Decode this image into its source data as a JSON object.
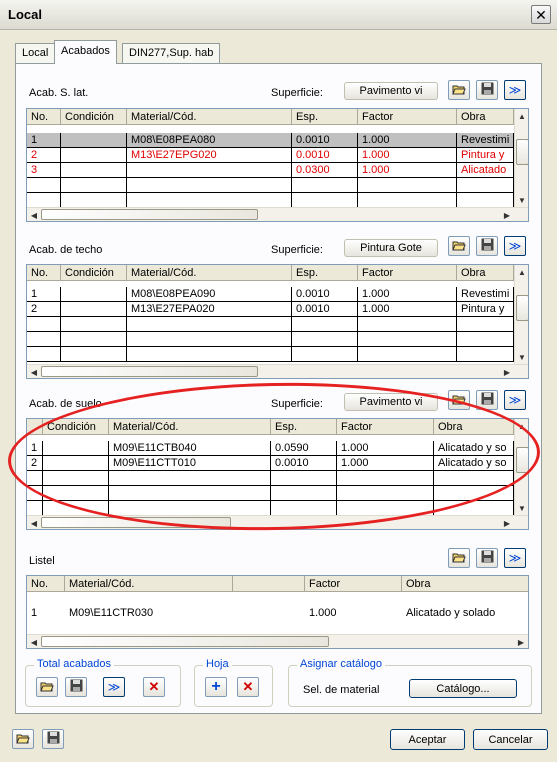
{
  "window": {
    "title": "Local"
  },
  "tabs": [
    "Local",
    "Acabados",
    "DIN277,Sup. hab"
  ],
  "sections": {
    "lat": {
      "title": "Acab. S. lat.",
      "superficie_label": "Superficie:",
      "superficie_value": "Pavimento vi",
      "headers": [
        "No.",
        "Condición",
        "Material/Cód.",
        "Esp.",
        "Factor",
        "Obra"
      ],
      "rows": [
        [
          "1",
          "",
          "M08\\E08PEA080",
          "0.0010",
          "1.000",
          "Revestimi"
        ],
        [
          "2",
          "",
          "M13\\E27EPG020",
          "0.0010",
          "1.000",
          "Pintura y"
        ],
        [
          "3",
          "",
          "",
          "0.0300",
          "1.000",
          "Alicatado"
        ]
      ]
    },
    "techo": {
      "title": "Acab. de techo",
      "superficie_label": "Superficie:",
      "superficie_value": "Pintura Gote",
      "headers": [
        "No.",
        "Condición",
        "Material/Cód.",
        "Esp.",
        "Factor",
        "Obra"
      ],
      "rows": [
        [
          "1",
          "",
          "M08\\E08PEA090",
          "0.0010",
          "1.000",
          "Revestimi"
        ],
        [
          "2",
          "",
          "M13\\E27EPA020",
          "0.0010",
          "1.000",
          "Pintura y"
        ]
      ]
    },
    "suelo": {
      "title": "Acab. de suelo",
      "superficie_label": "Superficie:",
      "superficie_value": "Pavimento vi",
      "headers": [
        "",
        "Condición",
        "Material/Cód.",
        "Esp.",
        "Factor",
        "Obra"
      ],
      "rows": [
        [
          "1",
          "",
          "M09\\E11CTB040",
          "0.0590",
          "1.000",
          "Alicatado y so"
        ],
        [
          "2",
          "",
          "M09\\E11CTT010",
          "0.0010",
          "1.000",
          "Alicatado y so"
        ]
      ]
    },
    "listel": {
      "title": "Listel",
      "headers": [
        "No.",
        "Material/Cód.",
        "",
        "Factor",
        "Obra"
      ],
      "rows": [
        [
          "1",
          "M09\\E11CTR030",
          "",
          "1.000",
          "Alicatado y solado"
        ]
      ]
    }
  },
  "groups": {
    "total": {
      "label": "Total acabados"
    },
    "hoja": {
      "label": "Hoja"
    },
    "catalogo": {
      "label": "Asignar catálogo",
      "sel_label": "Sel. de material",
      "button": "Catálogo..."
    }
  },
  "footer": {
    "accept": "Aceptar",
    "cancel": "Cancelar"
  },
  "icons": {
    "forward_glyph": "≫",
    "add_glyph": "+",
    "delete_glyph": "✕",
    "close_glyph": "✕"
  },
  "colors": {
    "red_row": "#e00000",
    "selected_row": "#c0c0c0",
    "link_blue": "#0046d5"
  }
}
